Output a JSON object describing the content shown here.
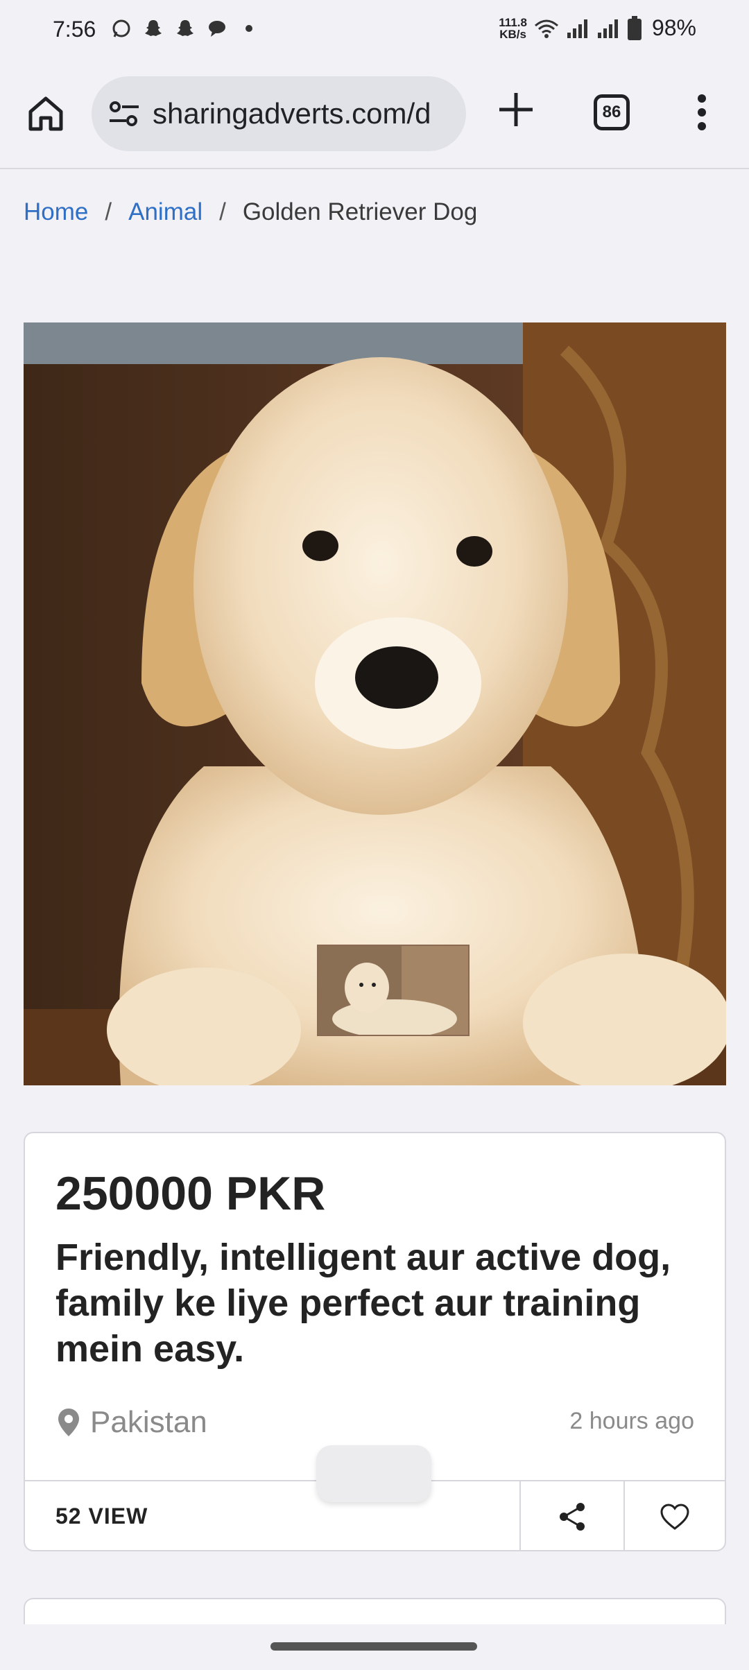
{
  "status_bar": {
    "time": "7:56",
    "net_speed_top": "111.8",
    "net_speed_bottom": "KB/s",
    "battery": "98%"
  },
  "toolbar": {
    "url": "sharingadverts.com/d",
    "tab_count": "86"
  },
  "breadcrumb": {
    "items": [
      "Home",
      "Animal"
    ],
    "separator": "/",
    "current": "Golden Retriever Dog"
  },
  "listing": {
    "price": "250000 PKR",
    "title": "Friendly, intelligent aur active dog, family ke liye perfect aur training mein easy.",
    "location": "Pakistan",
    "posted": "2 hours ago",
    "views": "52 VIEW"
  },
  "colors": {
    "link": "#2f6fc5",
    "background": "#f1f1f6",
    "muted_text": "#8a8a8a"
  },
  "icons": {
    "home": "home-icon",
    "site_settings": "tune-icon",
    "new_tab": "plus-icon",
    "menu": "more-vert-icon",
    "location": "map-pin-icon",
    "share": "share-icon",
    "favorite": "heart-icon"
  }
}
